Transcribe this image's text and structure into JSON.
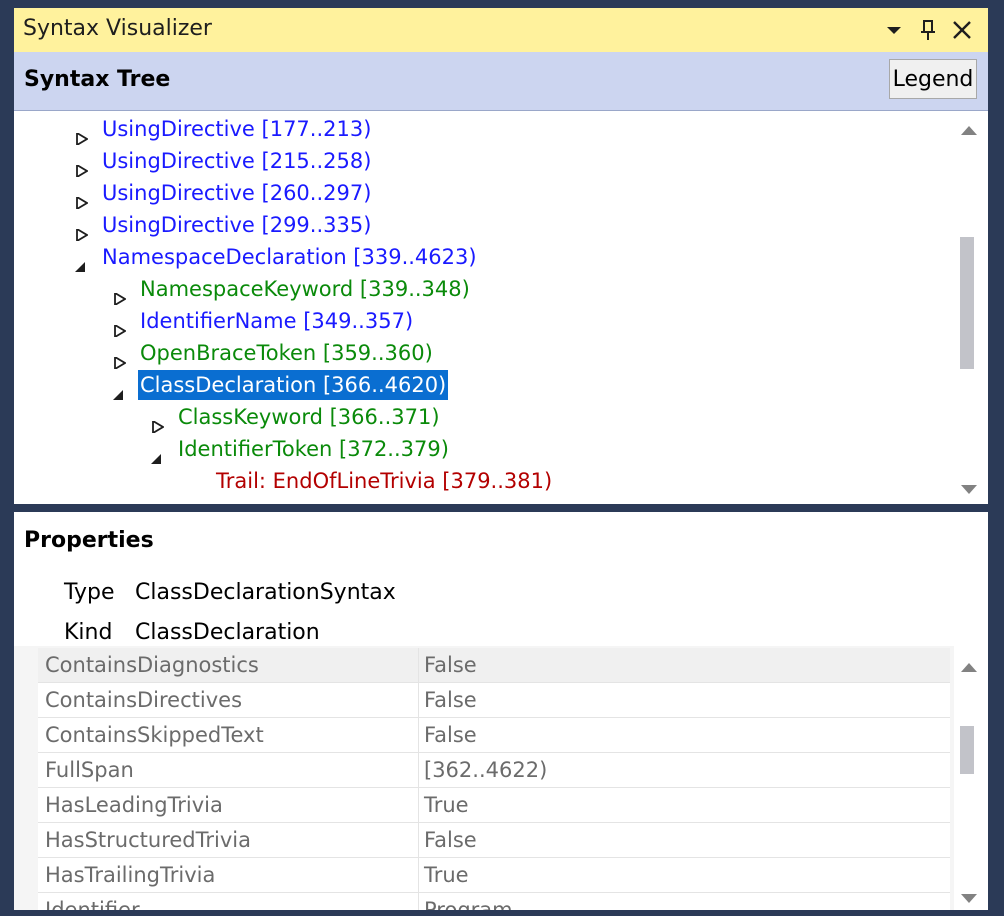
{
  "window": {
    "title": "Syntax Visualizer",
    "colors": {
      "title_bg": "#fff29d",
      "header_bg": "#ccd5f0",
      "frame": "#2b3a57",
      "selection": "#0a6ed1"
    }
  },
  "tree_header": {
    "title": "Syntax Tree",
    "legend_button": "Legend"
  },
  "tree": [
    {
      "label": "UsingDirective [177..213)",
      "state": "collapsed",
      "color": "blue"
    },
    {
      "label": "UsingDirective [215..258)",
      "state": "collapsed",
      "color": "blue"
    },
    {
      "label": "UsingDirective [260..297)",
      "state": "collapsed",
      "color": "blue"
    },
    {
      "label": "UsingDirective [299..335)",
      "state": "collapsed",
      "color": "blue"
    },
    {
      "label": "NamespaceDeclaration [339..4623)",
      "state": "expanded",
      "color": "blue"
    },
    {
      "label": "NamespaceKeyword [339..348)",
      "state": "collapsed",
      "color": "green"
    },
    {
      "label": "IdentifierName [349..357)",
      "state": "collapsed",
      "color": "blue"
    },
    {
      "label": "OpenBraceToken [359..360)",
      "state": "collapsed",
      "color": "green"
    },
    {
      "label": "ClassDeclaration [366..4620)",
      "state": "expanded",
      "color": "blue",
      "selected": true
    },
    {
      "label": "ClassKeyword [366..371)",
      "state": "collapsed",
      "color": "green"
    },
    {
      "label": "IdentifierToken [372..379)",
      "state": "expanded",
      "color": "green"
    },
    {
      "label": "Trail: EndOfLineTrivia [379..381)",
      "state": "leaf",
      "color": "red"
    }
  ],
  "properties": {
    "title": "Properties",
    "type_label": "Type",
    "type_value": "ClassDeclarationSyntax",
    "kind_label": "Kind",
    "kind_value": "ClassDeclaration",
    "grid": [
      {
        "name": "ContainsDiagnostics",
        "value": "False"
      },
      {
        "name": "ContainsDirectives",
        "value": "False"
      },
      {
        "name": "ContainsSkippedText",
        "value": "False"
      },
      {
        "name": "FullSpan",
        "value": "[362..4622)"
      },
      {
        "name": "HasLeadingTrivia",
        "value": "True"
      },
      {
        "name": "HasStructuredTrivia",
        "value": "False"
      },
      {
        "name": "HasTrailingTrivia",
        "value": "True"
      },
      {
        "name": "Identifier",
        "value": "Program"
      }
    ]
  }
}
